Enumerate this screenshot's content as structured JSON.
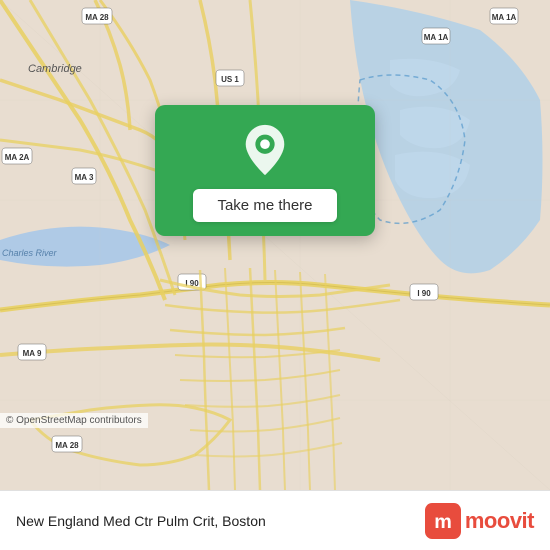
{
  "map": {
    "background_color": "#e8e0d8",
    "popup": {
      "button_label": "Take me there",
      "bg_color": "#34a853"
    },
    "copyright": "© OpenStreetMap contributors"
  },
  "bottom_bar": {
    "location_text": "New England Med Ctr Pulm Crit, Boston",
    "moovit_label": "moovit"
  },
  "road_labels": [
    "Cambridge",
    "MA 28",
    "US 1",
    "MA 1A",
    "MA 2A",
    "MA 3",
    "MA 9",
    "I 90",
    "MA 9",
    "MA 28",
    "I 90",
    "Charles River"
  ]
}
